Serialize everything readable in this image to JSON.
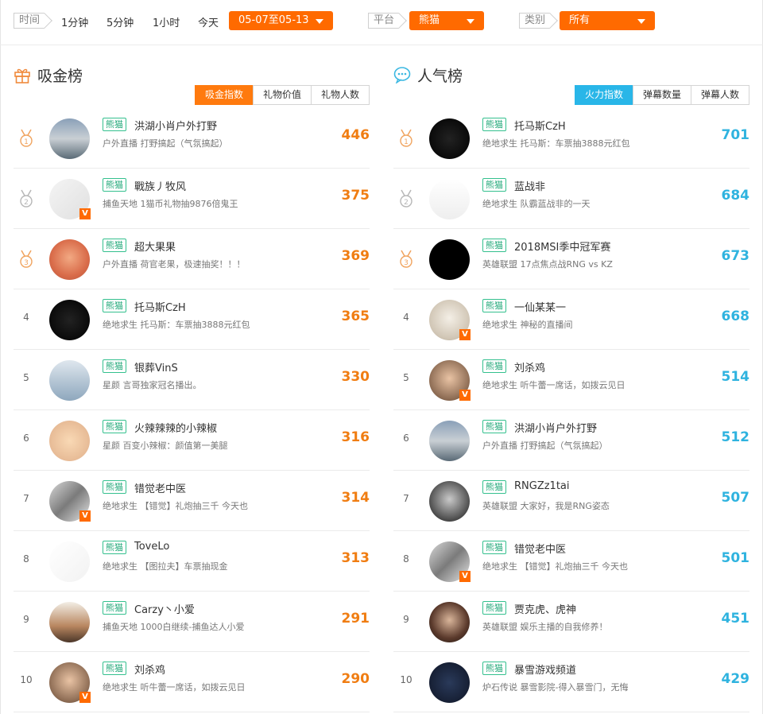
{
  "filters": {
    "time_label": "时间",
    "time_options": [
      "1分钟",
      "5分钟",
      "1小时",
      "今天"
    ],
    "date_range": "05-07至05-13",
    "platform_label": "平台",
    "platform_value": "熊猫",
    "category_label": "类别",
    "category_value": "所有"
  },
  "colors": {
    "orange": "#ff6a00",
    "blue": "#29b6e8",
    "green": "#34c08e"
  },
  "left": {
    "title": "吸金榜",
    "icon": "gift-icon",
    "tabs": [
      "吸金指数",
      "礼物价值",
      "礼物人数"
    ],
    "rows": [
      {
        "rank": "1",
        "platform": "熊猫",
        "name": "洪湖小肖户外打野",
        "desc": "户外直播 打野搞起（气氛搞起）",
        "score": "446"
      },
      {
        "rank": "2",
        "platform": "熊猫",
        "name": "戰族丿牧风",
        "desc": "捕鱼天地 1猫币礼物抽9876倍鬼王",
        "score": "375"
      },
      {
        "rank": "3",
        "platform": "熊猫",
        "name": "超大果果",
        "desc": "户外直播 荷官老果，极速抽奖！！！",
        "score": "369"
      },
      {
        "rank": "4",
        "platform": "熊猫",
        "name": "托马斯CzH",
        "desc": "绝地求生 托马斯：车票抽3888元红包",
        "score": "365"
      },
      {
        "rank": "5",
        "platform": "熊猫",
        "name": "银葬VinS",
        "desc": "星颜 言哥独家冠名播出。",
        "score": "330"
      },
      {
        "rank": "6",
        "platform": "熊猫",
        "name": "火辣辣辣的小辣椒",
        "desc": "星颜 百变小辣椒：颜值第一美腿",
        "score": "316"
      },
      {
        "rank": "7",
        "platform": "熊猫",
        "name": "错觉老中医",
        "desc": "绝地求生 【错觉】礼炮抽三千 今天也",
        "score": "314"
      },
      {
        "rank": "8",
        "platform": "熊猫",
        "name": "ToveLo",
        "desc": "绝地求生 【图拉夫】车票抽现金",
        "score": "313"
      },
      {
        "rank": "9",
        "platform": "熊猫",
        "name": "Carzy丶小爱",
        "desc": "捕鱼天地 1000白继续-捕鱼达人小爱",
        "score": "291"
      },
      {
        "rank": "10",
        "platform": "熊猫",
        "name": "刘杀鸡",
        "desc": "绝地求生 听牛蕾一席话，如拨云见日",
        "score": "290"
      }
    ]
  },
  "right": {
    "title": "人气榜",
    "icon": "chat-bubble-icon",
    "tabs": [
      "火力指数",
      "弹幕数量",
      "弹幕人数"
    ],
    "rows": [
      {
        "rank": "1",
        "platform": "熊猫",
        "name": "托马斯CzH",
        "desc": "绝地求生 托马斯：车票抽3888元红包",
        "score": "701"
      },
      {
        "rank": "2",
        "platform": "熊猫",
        "name": "蓝战非",
        "desc": "绝地求生 队霸蓝战非的一天",
        "score": "684"
      },
      {
        "rank": "3",
        "platform": "熊猫",
        "name": "2018MSI季中冠军赛",
        "desc": "英雄联盟 17点焦点战RNG vs KZ",
        "score": "673"
      },
      {
        "rank": "4",
        "platform": "熊猫",
        "name": "一仙某某一",
        "desc": "绝地求生 神秘的直播间",
        "score": "668"
      },
      {
        "rank": "5",
        "platform": "熊猫",
        "name": "刘杀鸡",
        "desc": "绝地求生 听牛蕾一席话，如拨云见日",
        "score": "514"
      },
      {
        "rank": "6",
        "platform": "熊猫",
        "name": "洪湖小肖户外打野",
        "desc": "户外直播 打野搞起（气氛搞起）",
        "score": "512"
      },
      {
        "rank": "7",
        "platform": "熊猫",
        "name": "RNGZz1tai",
        "desc": "英雄联盟 大家好，我是RNG姿态",
        "score": "507"
      },
      {
        "rank": "8",
        "platform": "熊猫",
        "name": "错觉老中医",
        "desc": "绝地求生 【错觉】礼炮抽三千 今天也",
        "score": "501"
      },
      {
        "rank": "9",
        "platform": "熊猫",
        "name": "贾克虎、虎神",
        "desc": "英雄联盟 娱乐主播的自我修养！",
        "score": "451"
      },
      {
        "rank": "10",
        "platform": "熊猫",
        "name": "暴雪游戏频道",
        "desc": "炉石传说 暴雪影院-得入暴雪门，无悔",
        "score": "429"
      }
    ]
  }
}
